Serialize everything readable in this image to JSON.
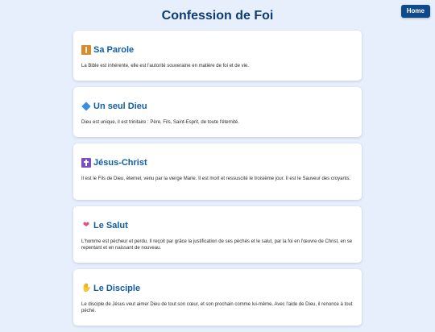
{
  "header": {
    "title": "Confession de Foi",
    "home_label": "Home"
  },
  "cards": [
    {
      "icon": "book-icon",
      "title": "Sa Parole",
      "text": "La Bible est inhérente, elle est l'autorité souveraine en matière de foi et de vie."
    },
    {
      "icon": "blue-diamond-icon",
      "title": "Un seul Dieu",
      "text": "Dieu est unique, il est trinitaire : Père, Fils, Saint-Esprit, de toute l'éternité."
    },
    {
      "icon": "cross-icon",
      "title": "Jésus-Christ",
      "text": "Il est le Fils de Dieu, éternel, venu par la vierge Marie. Il est mort et ressuscité le troisième jour. Il est le Sauveur des croyants."
    },
    {
      "icon": "heart-icon",
      "title": "Le Salut",
      "text": "L'homme est pécheur et perdu. Il reçoit par grâce la justification de ses péchés et le salut, par la foi en l'œuvre de Christ, en se repentant et en naissant de nouveau."
    },
    {
      "icon": "praying-hands-icon",
      "title": "Le Disciple",
      "text": "Le disciple de Jésus veut aimer Dieu de tout son cœur, et son prochain comme lui-même. Avec l'aide de Dieu, il renonce à tout péché."
    }
  ]
}
